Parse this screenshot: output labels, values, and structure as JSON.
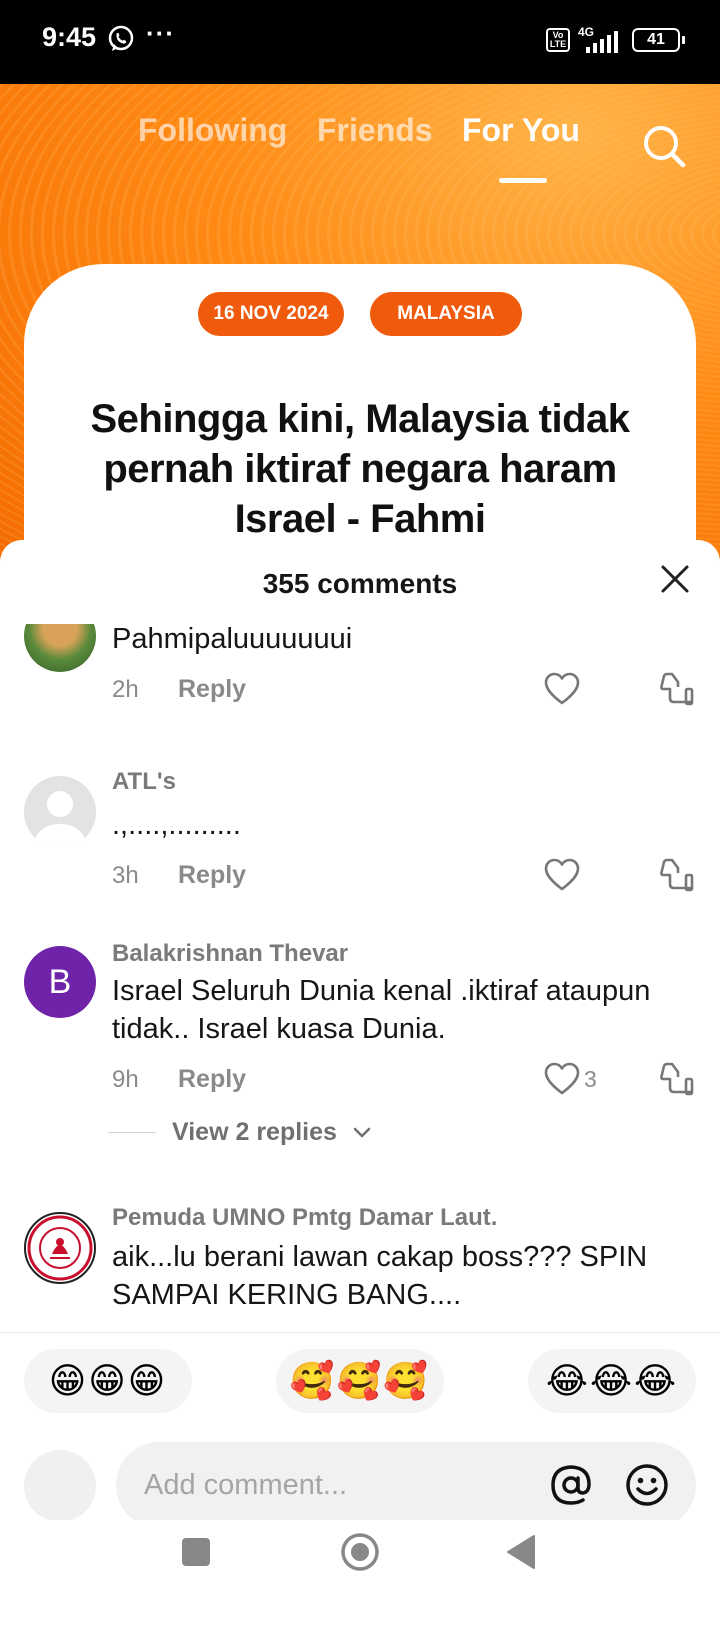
{
  "status_bar": {
    "time": "9:45",
    "dots": "···",
    "volte": "Vo LTE",
    "network": "4G",
    "battery": "41"
  },
  "top_nav": {
    "tabs": [
      {
        "label": "Following"
      },
      {
        "label": "Friends"
      },
      {
        "label": "For You"
      }
    ],
    "active_tab": "For You"
  },
  "video": {
    "chips": [
      "16 NOV 2024",
      "MALAYSIA"
    ],
    "headline": "Sehingga kini, Malaysia tidak pernah iktiraf negara haram Israel - Fahmi"
  },
  "comments_sheet": {
    "title": "355 comments",
    "comments": [
      {
        "username": "",
        "text": "Pahmipaluuuuuuui",
        "time": "2h",
        "reply_label": "Reply",
        "likes": ""
      },
      {
        "username": "ATL's",
        "text": ".,....,.........",
        "time": "3h",
        "reply_label": "Reply",
        "likes": ""
      },
      {
        "username": "Balakrishnan Thevar",
        "avatar_letter": "B",
        "text": "Israel Seluruh Dunia kenal .iktiraf ataupun tidak.. Israel kuasa Dunia.",
        "time": "9h",
        "reply_label": "Reply",
        "likes": "3",
        "view_replies": "View 2 replies"
      },
      {
        "username": "Pemuda UMNO Pmtg Damar Laut.",
        "text": "aik...lu berani lawan cakap boss??? SPIN SAMPAI KERING BANG....",
        "time": "",
        "reply_label": "",
        "likes": ""
      }
    ]
  },
  "emoji_bar": [
    "😁😁😁",
    "🥰🥰🥰",
    "😂😂😂"
  ],
  "composer": {
    "placeholder": "Add comment..."
  },
  "colors": {
    "accent_orange": "#f05a0c",
    "avatar_purple": "#6f23a8",
    "text_gray": "#8a8a8a"
  }
}
